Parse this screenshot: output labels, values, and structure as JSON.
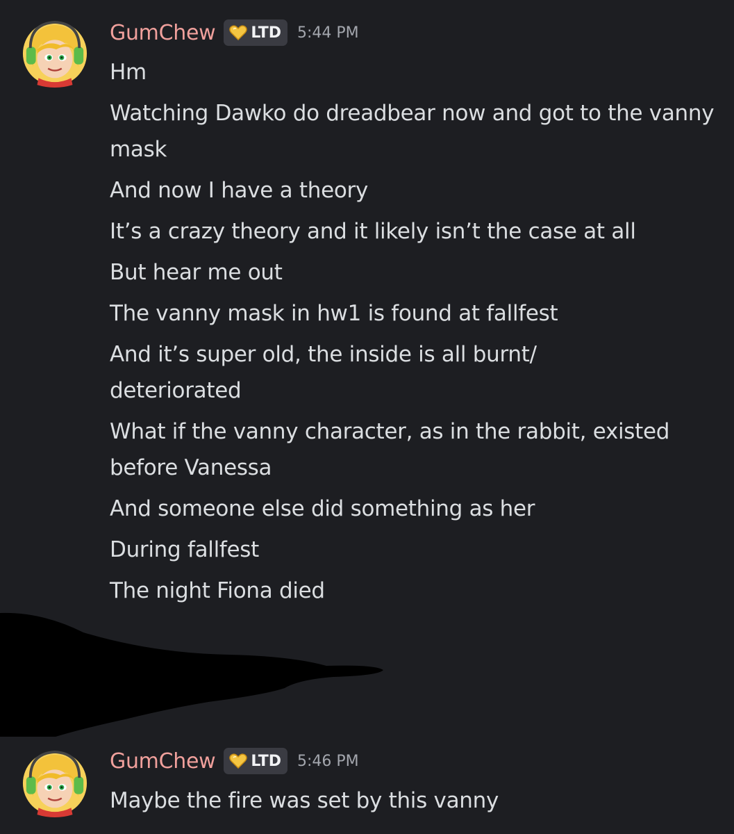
{
  "colors": {
    "background": "#1d1e22",
    "username": "#f0a09c",
    "message_text": "#dbdee1",
    "timestamp": "#a3a6ad",
    "tag_background": "#3a3b42",
    "tag_heart": "#f4c542"
  },
  "messages": [
    {
      "username": "GumChew",
      "tag": {
        "icon": "heart-icon",
        "label": "LTD"
      },
      "time": "5:44 PM",
      "lines": [
        "Hm",
        "Watching Dawko do dreadbear now and got to the vanny mask",
        "And now I have a theory",
        "It’s a crazy theory and it likely isn’t the case at all",
        "But hear me out",
        "The vanny mask in hw1 is found at fallfest",
        "And it’s super old, the inside is all burnt/ deteriorated",
        "What if the vanny character, as in the rabbit, existed before Vanessa",
        "And someone else did something as her",
        "During fallfest",
        "The night Fiona died"
      ]
    },
    {
      "username": "GumChew",
      "tag": {
        "icon": "heart-icon",
        "label": "LTD"
      },
      "time": "5:46 PM",
      "lines": [
        "Maybe the fire was set by this vanny"
      ]
    }
  ]
}
